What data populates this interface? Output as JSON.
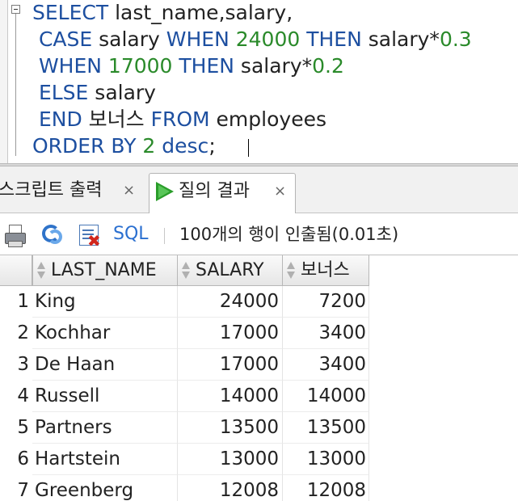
{
  "editor": {
    "lines": [
      [
        [
          "kw",
          "SELECT"
        ],
        [
          "t",
          " last_name,salary,"
        ]
      ],
      [
        [
          "t",
          " "
        ],
        [
          "kw",
          "CASE"
        ],
        [
          "t",
          " salary "
        ],
        [
          "kw",
          "WHEN"
        ],
        [
          "t",
          " "
        ],
        [
          "num",
          "24000"
        ],
        [
          "t",
          " "
        ],
        [
          "kw",
          "THEN"
        ],
        [
          "t",
          " salary*"
        ],
        [
          "num",
          "0.3"
        ]
      ],
      [
        [
          "t",
          " "
        ],
        [
          "kw",
          "WHEN"
        ],
        [
          "t",
          " "
        ],
        [
          "num",
          "17000"
        ],
        [
          "t",
          " "
        ],
        [
          "kw",
          "THEN"
        ],
        [
          "t",
          " salary*"
        ],
        [
          "num",
          "0.2"
        ]
      ],
      [
        [
          "t",
          " "
        ],
        [
          "kw",
          "ELSE"
        ],
        [
          "t",
          " salary"
        ]
      ],
      [
        [
          "t",
          " "
        ],
        [
          "kw",
          "END"
        ],
        [
          "t",
          " 보너스 "
        ],
        [
          "kw",
          "FROM"
        ],
        [
          "t",
          " employees"
        ]
      ],
      [
        [
          "kw",
          "ORDER BY"
        ],
        [
          "t",
          " "
        ],
        [
          "num",
          "2"
        ],
        [
          "t",
          " "
        ],
        [
          "kw",
          "desc"
        ],
        [
          "t",
          ";"
        ]
      ]
    ]
  },
  "tabs": [
    {
      "label": "스크립트 출력",
      "close": "×",
      "active": false
    },
    {
      "label": "질의 결과",
      "close": "×",
      "active": true
    }
  ],
  "toolbar": {
    "sql_label": "SQL",
    "separator": "|",
    "status": "100개의 행이 인출됨(0.01초)"
  },
  "grid": {
    "columns": [
      "LAST_NAME",
      "SALARY",
      "보너스"
    ],
    "rows": [
      {
        "n": "1",
        "name": "King",
        "salary": "24000",
        "bonus": "7200"
      },
      {
        "n": "2",
        "name": "Kochhar",
        "salary": "17000",
        "bonus": "3400"
      },
      {
        "n": "3",
        "name": "De Haan",
        "salary": "17000",
        "bonus": "3400"
      },
      {
        "n": "4",
        "name": "Russell",
        "salary": "14000",
        "bonus": "14000"
      },
      {
        "n": "5",
        "name": "Partners",
        "salary": "13500",
        "bonus": "13500"
      },
      {
        "n": "6",
        "name": "Hartstein",
        "salary": "13000",
        "bonus": "13000"
      },
      {
        "n": "7",
        "name": "Greenberg",
        "salary": "12008",
        "bonus": "12008"
      }
    ]
  },
  "colors": {
    "keyword": "#1d4fa0",
    "number": "#2a8a2a",
    "run_green": "#2a9d2a",
    "link_blue": "#2a6fd0"
  }
}
